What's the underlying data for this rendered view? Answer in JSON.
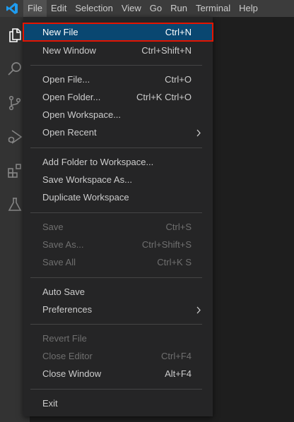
{
  "menubar": {
    "items": [
      "File",
      "Edit",
      "Selection",
      "View",
      "Go",
      "Run",
      "Terminal",
      "Help"
    ],
    "active": "File"
  },
  "activity_bar": {
    "icons": [
      "explorer-icon",
      "search-icon",
      "source-control-icon",
      "run-debug-icon",
      "extensions-icon",
      "testing-icon"
    ]
  },
  "file_menu": {
    "groups": [
      [
        {
          "label": "New File",
          "shortcut": "Ctrl+N",
          "enabled": true,
          "selected": true
        },
        {
          "label": "New Window",
          "shortcut": "Ctrl+Shift+N",
          "enabled": true
        }
      ],
      [
        {
          "label": "Open File...",
          "shortcut": "Ctrl+O",
          "enabled": true
        },
        {
          "label": "Open Folder...",
          "shortcut": "Ctrl+K Ctrl+O",
          "enabled": true
        },
        {
          "label": "Open Workspace...",
          "shortcut": "",
          "enabled": true
        },
        {
          "label": "Open Recent",
          "shortcut": "",
          "enabled": true,
          "submenu": true
        }
      ],
      [
        {
          "label": "Add Folder to Workspace...",
          "shortcut": "",
          "enabled": true
        },
        {
          "label": "Save Workspace As...",
          "shortcut": "",
          "enabled": true
        },
        {
          "label": "Duplicate Workspace",
          "shortcut": "",
          "enabled": true
        }
      ],
      [
        {
          "label": "Save",
          "shortcut": "Ctrl+S",
          "enabled": false
        },
        {
          "label": "Save As...",
          "shortcut": "Ctrl+Shift+S",
          "enabled": false
        },
        {
          "label": "Save All",
          "shortcut": "Ctrl+K S",
          "enabled": false
        }
      ],
      [
        {
          "label": "Auto Save",
          "shortcut": "",
          "enabled": true
        },
        {
          "label": "Preferences",
          "shortcut": "",
          "enabled": true,
          "submenu": true
        }
      ],
      [
        {
          "label": "Revert File",
          "shortcut": "",
          "enabled": false
        },
        {
          "label": "Close Editor",
          "shortcut": "Ctrl+F4",
          "enabled": false
        },
        {
          "label": "Close Window",
          "shortcut": "Alt+F4",
          "enabled": true
        }
      ],
      [
        {
          "label": "Exit",
          "shortcut": "",
          "enabled": true
        }
      ]
    ]
  },
  "colors": {
    "menubar_bg": "#3c3c3c",
    "menu_bg": "#252526",
    "selected_bg": "#094771",
    "highlight_outline": "#e51400",
    "text": "#cccccc",
    "disabled_text": "#6f6f6f"
  }
}
